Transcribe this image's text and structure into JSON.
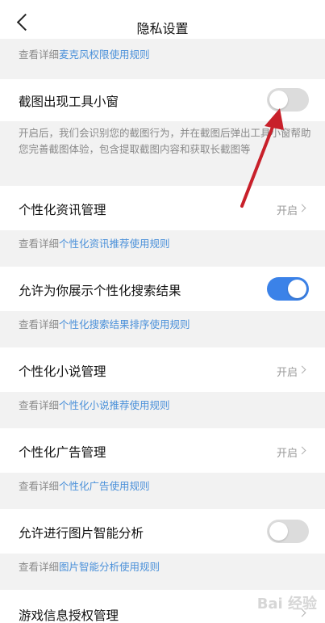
{
  "header": {
    "title": "隐私设置"
  },
  "top_info": {
    "prefix": "查看详细",
    "link": "麦克风权限使用规则"
  },
  "screenshot_toolbar": {
    "label": "截图出现工具小窗",
    "enabled": false,
    "description": "开启后，我们会识别您的截图行为，并在截图后弹出工具小窗帮助您完善截图体验，包含提取截图内容和获取长截图等"
  },
  "news": {
    "label": "个性化资讯管理",
    "status": "开启",
    "info_prefix": "查看详细",
    "info_link": "个性化资讯推荐使用规则"
  },
  "search": {
    "label": "允许为你展示个性化搜索结果",
    "enabled": true,
    "info_prefix": "查看详细",
    "info_link": "个性化搜索结果排序使用规则"
  },
  "novel": {
    "label": "个性化小说管理",
    "status": "开启",
    "info_prefix": "查看详细",
    "info_link": "个性化小说推荐使用规则"
  },
  "ads": {
    "label": "个性化广告管理",
    "status": "开启",
    "info_prefix": "查看详细",
    "info_link": "个性化广告使用规则"
  },
  "image_analysis": {
    "label": "允许进行图片智能分析",
    "enabled": false,
    "info_prefix": "查看详细",
    "info_link": "图片智能分析使用规则"
  },
  "game": {
    "label": "游戏信息授权管理"
  },
  "watermark": "Bai 经验",
  "colors": {
    "accent": "#3b82e8",
    "link": "#4a90d9",
    "arrow": "#c8202a"
  }
}
